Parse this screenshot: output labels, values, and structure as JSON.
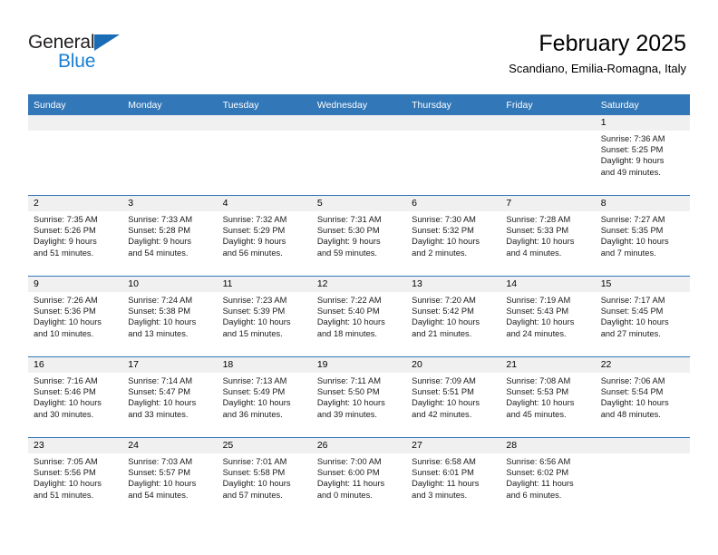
{
  "brand": {
    "line1": "General",
    "line2": "Blue",
    "triangle_color": "#1a6cb5",
    "line2_color": "#1a7fd4"
  },
  "header": {
    "title": "February 2025",
    "subtitle": "Scandiano, Emilia-Romagna, Italy"
  },
  "theme": {
    "header_bg": "#3277b8",
    "daynum_band": "#f0f0f0",
    "row_divider": "#3277b8",
    "text": "#1a1a1a"
  },
  "weekday_headers": [
    "Sunday",
    "Monday",
    "Tuesday",
    "Wednesday",
    "Thursday",
    "Friday",
    "Saturday"
  ],
  "weeks": [
    [
      {
        "day": "",
        "empty": true
      },
      {
        "day": "",
        "empty": true
      },
      {
        "day": "",
        "empty": true
      },
      {
        "day": "",
        "empty": true
      },
      {
        "day": "",
        "empty": true
      },
      {
        "day": "",
        "empty": true
      },
      {
        "day": "1",
        "sunrise": "Sunrise: 7:36 AM",
        "sunset": "Sunset: 5:25 PM",
        "daylight1": "Daylight: 9 hours",
        "daylight2": "and 49 minutes."
      }
    ],
    [
      {
        "day": "2",
        "sunrise": "Sunrise: 7:35 AM",
        "sunset": "Sunset: 5:26 PM",
        "daylight1": "Daylight: 9 hours",
        "daylight2": "and 51 minutes."
      },
      {
        "day": "3",
        "sunrise": "Sunrise: 7:33 AM",
        "sunset": "Sunset: 5:28 PM",
        "daylight1": "Daylight: 9 hours",
        "daylight2": "and 54 minutes."
      },
      {
        "day": "4",
        "sunrise": "Sunrise: 7:32 AM",
        "sunset": "Sunset: 5:29 PM",
        "daylight1": "Daylight: 9 hours",
        "daylight2": "and 56 minutes."
      },
      {
        "day": "5",
        "sunrise": "Sunrise: 7:31 AM",
        "sunset": "Sunset: 5:30 PM",
        "daylight1": "Daylight: 9 hours",
        "daylight2": "and 59 minutes."
      },
      {
        "day": "6",
        "sunrise": "Sunrise: 7:30 AM",
        "sunset": "Sunset: 5:32 PM",
        "daylight1": "Daylight: 10 hours",
        "daylight2": "and 2 minutes."
      },
      {
        "day": "7",
        "sunrise": "Sunrise: 7:28 AM",
        "sunset": "Sunset: 5:33 PM",
        "daylight1": "Daylight: 10 hours",
        "daylight2": "and 4 minutes."
      },
      {
        "day": "8",
        "sunrise": "Sunrise: 7:27 AM",
        "sunset": "Sunset: 5:35 PM",
        "daylight1": "Daylight: 10 hours",
        "daylight2": "and 7 minutes."
      }
    ],
    [
      {
        "day": "9",
        "sunrise": "Sunrise: 7:26 AM",
        "sunset": "Sunset: 5:36 PM",
        "daylight1": "Daylight: 10 hours",
        "daylight2": "and 10 minutes."
      },
      {
        "day": "10",
        "sunrise": "Sunrise: 7:24 AM",
        "sunset": "Sunset: 5:38 PM",
        "daylight1": "Daylight: 10 hours",
        "daylight2": "and 13 minutes."
      },
      {
        "day": "11",
        "sunrise": "Sunrise: 7:23 AM",
        "sunset": "Sunset: 5:39 PM",
        "daylight1": "Daylight: 10 hours",
        "daylight2": "and 15 minutes."
      },
      {
        "day": "12",
        "sunrise": "Sunrise: 7:22 AM",
        "sunset": "Sunset: 5:40 PM",
        "daylight1": "Daylight: 10 hours",
        "daylight2": "and 18 minutes."
      },
      {
        "day": "13",
        "sunrise": "Sunrise: 7:20 AM",
        "sunset": "Sunset: 5:42 PM",
        "daylight1": "Daylight: 10 hours",
        "daylight2": "and 21 minutes."
      },
      {
        "day": "14",
        "sunrise": "Sunrise: 7:19 AM",
        "sunset": "Sunset: 5:43 PM",
        "daylight1": "Daylight: 10 hours",
        "daylight2": "and 24 minutes."
      },
      {
        "day": "15",
        "sunrise": "Sunrise: 7:17 AM",
        "sunset": "Sunset: 5:45 PM",
        "daylight1": "Daylight: 10 hours",
        "daylight2": "and 27 minutes."
      }
    ],
    [
      {
        "day": "16",
        "sunrise": "Sunrise: 7:16 AM",
        "sunset": "Sunset: 5:46 PM",
        "daylight1": "Daylight: 10 hours",
        "daylight2": "and 30 minutes."
      },
      {
        "day": "17",
        "sunrise": "Sunrise: 7:14 AM",
        "sunset": "Sunset: 5:47 PM",
        "daylight1": "Daylight: 10 hours",
        "daylight2": "and 33 minutes."
      },
      {
        "day": "18",
        "sunrise": "Sunrise: 7:13 AM",
        "sunset": "Sunset: 5:49 PM",
        "daylight1": "Daylight: 10 hours",
        "daylight2": "and 36 minutes."
      },
      {
        "day": "19",
        "sunrise": "Sunrise: 7:11 AM",
        "sunset": "Sunset: 5:50 PM",
        "daylight1": "Daylight: 10 hours",
        "daylight2": "and 39 minutes."
      },
      {
        "day": "20",
        "sunrise": "Sunrise: 7:09 AM",
        "sunset": "Sunset: 5:51 PM",
        "daylight1": "Daylight: 10 hours",
        "daylight2": "and 42 minutes."
      },
      {
        "day": "21",
        "sunrise": "Sunrise: 7:08 AM",
        "sunset": "Sunset: 5:53 PM",
        "daylight1": "Daylight: 10 hours",
        "daylight2": "and 45 minutes."
      },
      {
        "day": "22",
        "sunrise": "Sunrise: 7:06 AM",
        "sunset": "Sunset: 5:54 PM",
        "daylight1": "Daylight: 10 hours",
        "daylight2": "and 48 minutes."
      }
    ],
    [
      {
        "day": "23",
        "sunrise": "Sunrise: 7:05 AM",
        "sunset": "Sunset: 5:56 PM",
        "daylight1": "Daylight: 10 hours",
        "daylight2": "and 51 minutes."
      },
      {
        "day": "24",
        "sunrise": "Sunrise: 7:03 AM",
        "sunset": "Sunset: 5:57 PM",
        "daylight1": "Daylight: 10 hours",
        "daylight2": "and 54 minutes."
      },
      {
        "day": "25",
        "sunrise": "Sunrise: 7:01 AM",
        "sunset": "Sunset: 5:58 PM",
        "daylight1": "Daylight: 10 hours",
        "daylight2": "and 57 minutes."
      },
      {
        "day": "26",
        "sunrise": "Sunrise: 7:00 AM",
        "sunset": "Sunset: 6:00 PM",
        "daylight1": "Daylight: 11 hours",
        "daylight2": "and 0 minutes."
      },
      {
        "day": "27",
        "sunrise": "Sunrise: 6:58 AM",
        "sunset": "Sunset: 6:01 PM",
        "daylight1": "Daylight: 11 hours",
        "daylight2": "and 3 minutes."
      },
      {
        "day": "28",
        "sunrise": "Sunrise: 6:56 AM",
        "sunset": "Sunset: 6:02 PM",
        "daylight1": "Daylight: 11 hours",
        "daylight2": "and 6 minutes."
      },
      {
        "day": "",
        "empty": true
      }
    ]
  ]
}
